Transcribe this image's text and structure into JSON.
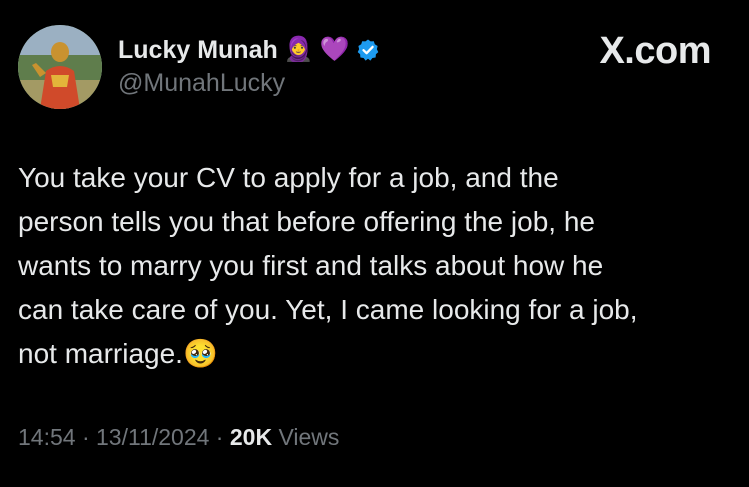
{
  "author": {
    "display_name": "Lucky Munah",
    "name_emojis": [
      "🧕",
      "💜"
    ],
    "handle": "@MunahLucky",
    "verified": true
  },
  "brand": "X.com",
  "tweet": {
    "lines": [
      "You take your CV to apply for a job, and the",
      "person tells you that before offering the job, he",
      "wants to marry you first and talks about how he",
      "can take care of you. Yet, I came looking for a job,",
      "not marriage.🥹"
    ]
  },
  "meta": {
    "time": "14:54",
    "separator": " · ",
    "date": "13/11/2024",
    "views_count": "20K",
    "views_label": " Views"
  },
  "colors": {
    "background": "#000000",
    "text": "#e7e9ea",
    "muted": "#71767b",
    "verified": "#1d9bf0"
  },
  "icons": {
    "verified": "verified-badge-icon",
    "avatar": "profile-photo"
  }
}
